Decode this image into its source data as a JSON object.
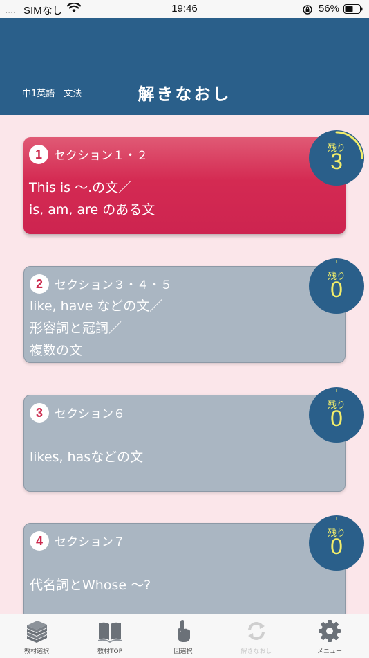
{
  "status_bar": {
    "carrier": "SIMなし",
    "time": "19:46",
    "battery_percent": "56%"
  },
  "header": {
    "subject": "中1英語　文法",
    "title": "解きなおし"
  },
  "remaining_label": "残り",
  "cards": [
    {
      "number": "1",
      "section": "セクション１・２",
      "lines": [
        "This is 〜.の文／",
        "is, am, are のある文"
      ],
      "remaining": "3",
      "active": true
    },
    {
      "number": "2",
      "section": "セクション３・４・５",
      "lines": [
        "like, have などの文／",
        "形容詞と冠詞／",
        "複数の文"
      ],
      "remaining": "0",
      "active": false
    },
    {
      "number": "3",
      "section": "セクション６",
      "lines": [
        "likes, hasなどの文"
      ],
      "remaining": "0",
      "active": false
    },
    {
      "number": "4",
      "section": "セクション７",
      "lines": [
        "代名詞とWhose 〜?"
      ],
      "remaining": "0",
      "active": false
    }
  ],
  "tab_bar": [
    {
      "label": "教材選択",
      "icon": "books-icon"
    },
    {
      "label": "教材TOP",
      "icon": "open-book-icon"
    },
    {
      "label": "回選択",
      "icon": "pointing-hand-icon"
    },
    {
      "label": "解きなおし",
      "icon": "refresh-icon",
      "disabled": true
    },
    {
      "label": "メニュー",
      "icon": "gear-icon"
    }
  ],
  "colors": {
    "header": "#2a5f8a",
    "background": "#fbe6ea",
    "active_card": "#d42a52",
    "inactive_card": "#aab6c2",
    "badge": "#2a5f8a",
    "badge_text": "#f3ee6a"
  }
}
